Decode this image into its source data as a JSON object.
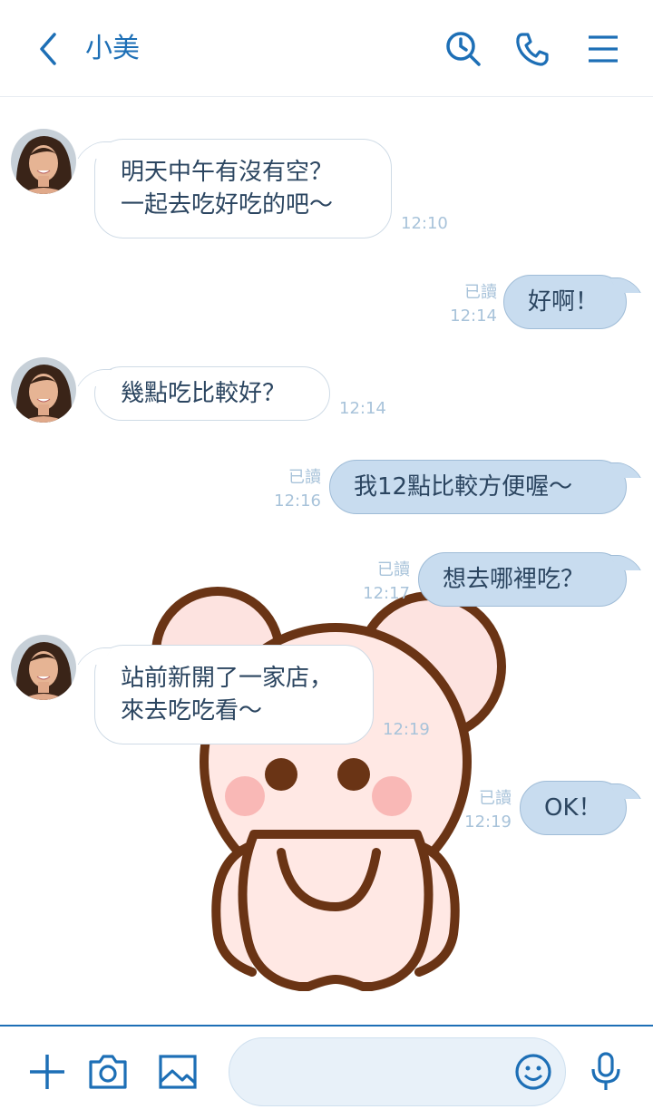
{
  "header": {
    "contact_name": "小美"
  },
  "messages": [
    {
      "side": "in",
      "lines": [
        "明天中午有沒有空？",
        "一起去吃好吃的吧～"
      ],
      "time": "12:10"
    },
    {
      "side": "out",
      "text": "好啊！",
      "read": "已讀",
      "time": "12:14"
    },
    {
      "side": "in",
      "lines": [
        "幾點吃比較好？"
      ],
      "time": "12:14"
    },
    {
      "side": "out",
      "text": "我12點比較方便喔～",
      "read": "已讀",
      "time": "12:16"
    },
    {
      "side": "out",
      "text": "想去哪裡吃？",
      "read": "已讀",
      "time": "12:17"
    },
    {
      "side": "in",
      "lines": [
        "站前新開了一家店，",
        "來去吃吃看～"
      ],
      "time": "12:19"
    },
    {
      "side": "out",
      "text": "OK！",
      "read": "已讀",
      "time": "12:19"
    }
  ],
  "composer": {
    "value": "",
    "placeholder": ""
  },
  "colors": {
    "accent": "#1d6fb6",
    "bubble_out": "#c8dcef",
    "meta_text": "#a8c3da"
  },
  "icons": [
    "back-icon",
    "search-history-icon",
    "phone-icon",
    "menu-icon",
    "plus-icon",
    "camera-icon",
    "image-icon",
    "emoji-icon",
    "microphone-icon"
  ]
}
